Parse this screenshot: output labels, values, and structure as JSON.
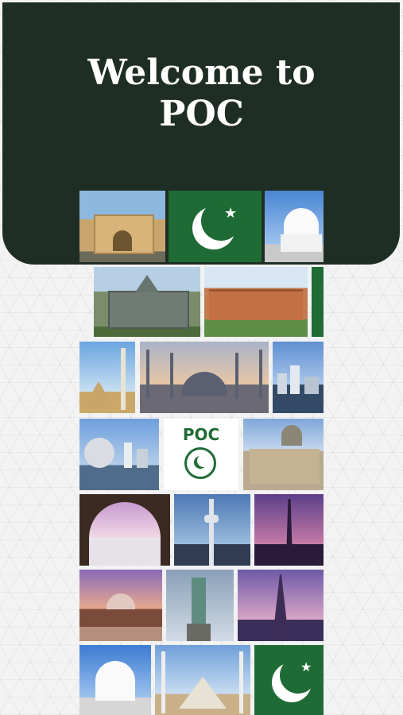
{
  "header": {
    "title_line1": "Welcome to",
    "title_line2": "POC"
  },
  "collage": {
    "logo_text": "POC",
    "tiles": [
      "khyber-pass-gate-photo",
      "pakistan-flag-icon",
      "mazar-e-quaid-photo",
      "colonial-building-photo",
      "peshawar-palace-photo",
      "faisal-mosque-minaret-photo",
      "blue-mosque-photo",
      "vancouver-skyline-photo",
      "science-world-dome-photo",
      "poc-logo",
      "trafalgar-gallery-photo",
      "badshahi-mosque-arch-photo",
      "kl-tower-photo",
      "minar-e-pakistan-photo",
      "badshahi-mosque-dusk-photo",
      "statue-of-liberty-photo",
      "eiffel-tower-photo",
      "mazar-e-quaid-photo-2",
      "faisal-mosque-photo",
      "pakistan-flag-icon-2"
    ]
  },
  "colors": {
    "header_bg": "#1f2e24",
    "flag_green": "#1f6b35",
    "logo_green": "#1f6b35"
  }
}
